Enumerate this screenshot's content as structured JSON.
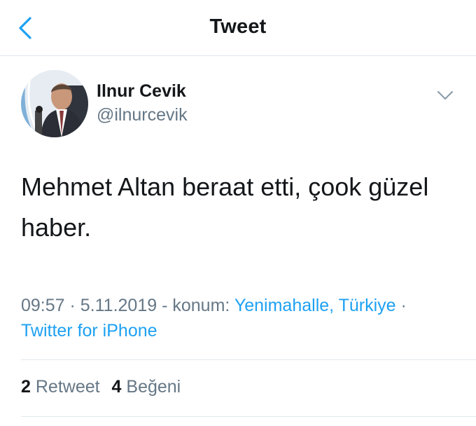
{
  "nav": {
    "title": "Tweet",
    "back_icon": "chevron-left-icon"
  },
  "colors": {
    "accent": "#1da1f2",
    "text_primary": "#14171a",
    "text_secondary": "#657786",
    "divider": "#e1e8ed"
  },
  "author": {
    "display_name": "Ilnur Cevik",
    "handle": "@ilnurcevik",
    "menu_icon": "chevron-down-icon"
  },
  "tweet": {
    "text_line1": "Mehmet Altan beraat etti, çook güzel",
    "text_line2": "haber."
  },
  "meta": {
    "time": "09:57",
    "sep1": " · ",
    "date": "5.11.2019",
    "location_prefix": " - konum: ",
    "location": "Yenimahalle, Türkiye",
    "sep2": " · ",
    "source": "Twitter for iPhone"
  },
  "stats": {
    "retweet_count": "2",
    "retweet_label": "Retweet",
    "like_count": "4",
    "like_label": "Beğeni"
  }
}
